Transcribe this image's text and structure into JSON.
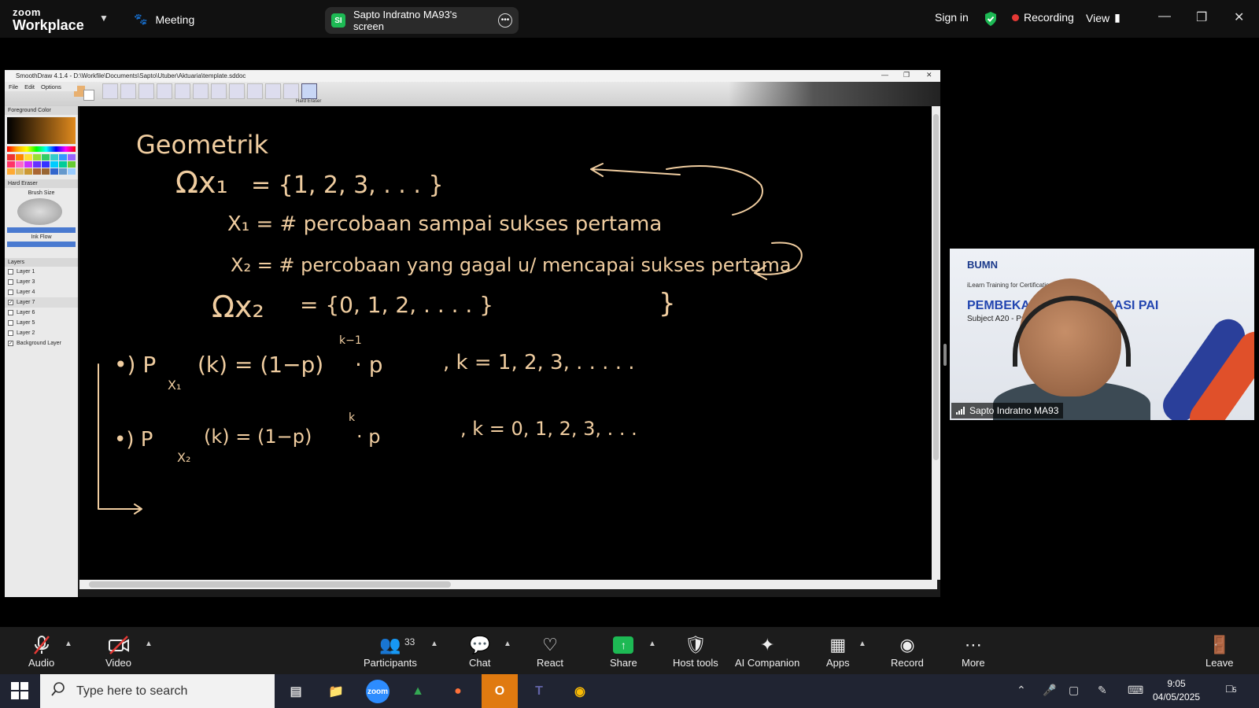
{
  "zoom": {
    "brand_top": "zoom",
    "brand_bottom": "Workplace",
    "meeting_label": "Meeting",
    "share_pill_initials": "SI",
    "share_pill_label": "Sapto Indratno MA93's screen",
    "sign_in": "Sign in",
    "recording": "Recording",
    "view": "View"
  },
  "smoothdraw": {
    "title": "SmoothDraw 4.1.4 - D:\\Workfile\\Documents\\Sapto\\Utuber\\Aktuaria\\template.sddoc",
    "menu": [
      "File",
      "Edit",
      "Options"
    ],
    "tool_caption": "Hard Eraser",
    "panels": {
      "foreground_color": "Foreground Color",
      "hard_eraser": "Hard Eraser",
      "brush_size": "Brush Size",
      "ink_flow": "Ink Flow",
      "layers": "Layers"
    },
    "layers": [
      {
        "name": "Layer 1",
        "checked": false
      },
      {
        "name": "Layer 3",
        "checked": false
      },
      {
        "name": "Layer 4",
        "checked": false
      },
      {
        "name": "Layer 7",
        "checked": true
      },
      {
        "name": "Layer 6",
        "checked": false
      },
      {
        "name": "Layer 5",
        "checked": false
      },
      {
        "name": "Layer 2",
        "checked": false
      },
      {
        "name": "Background Layer",
        "checked": true
      }
    ],
    "handwriting": {
      "heading": "Geometrik",
      "omega1_lhs": "Ωx₁",
      "omega1_rhs": "= {1, 2, 3, . . .   }",
      "x1_def": "X₁ = # percobaan sampai sukses pertama",
      "x2_def": "X₂ = # percobaan yang gagal u/ mencapai sukses pertama",
      "omega2_lhs": "Ωx₂",
      "omega2_rhs": "= {0, 1, 2,  . . . .   }",
      "pmf1_lhs": "•)  P",
      "pmf1_sub": "X₁",
      "pmf1_rhs": "(k) = (1−p)",
      "pmf1_exp": "k−1",
      "pmf1_tail": "· p",
      "pmf1_range": ",  k = 1, 2, 3, . . . . .",
      "pmf2_lhs": "•)  P",
      "pmf2_sub": "X₂",
      "pmf2_rhs": "(k) = (1−p)",
      "pmf2_exp": "k",
      "pmf2_tail": "· p",
      "pmf2_range": ",  k = 0, 1, 2, 3, . . ."
    }
  },
  "video_tile": {
    "logo": "BUMN",
    "small_text": "iLearn Training for Certification",
    "slide_title": "PEMBEKALA",
    "slide_title_right": "KASI PAI",
    "slide_sub": "Subject A20 - Probi",
    "participant_name": "Sapto Indratno MA93"
  },
  "toolbar": {
    "audio": "Audio",
    "video": "Video",
    "participants": "Participants",
    "participants_count": "33",
    "chat": "Chat",
    "react": "React",
    "share": "Share",
    "host_tools": "Host tools",
    "ai_companion": "AI Companion",
    "apps": "Apps",
    "record": "Record",
    "more": "More",
    "leave": "Leave"
  },
  "taskbar": {
    "search_placeholder": "Type here to search",
    "time": "9:05",
    "date": "04/05/2025",
    "notifications": "5"
  },
  "colors": {
    "ink": "#f0cda0",
    "zoom_green": "#1db954",
    "recording_red": "#e53935",
    "slide_blue": "#2245b0",
    "stripe_orange": "#e0502a"
  }
}
